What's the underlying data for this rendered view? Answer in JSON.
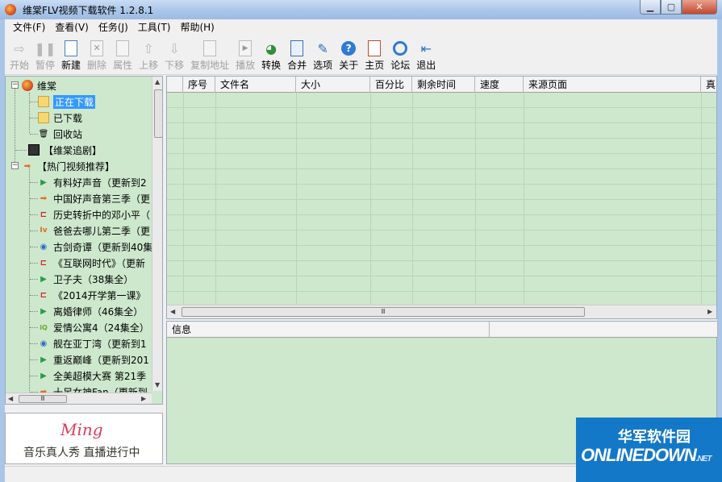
{
  "window": {
    "title": "维棠FLV视频下载软件 1.2.8.1",
    "minimize_icon": "minimize-icon",
    "maximize_icon": "maximize-icon",
    "close_icon": "close-icon"
  },
  "menu": [
    "文件(F)",
    "查看(V)",
    "任务(J)",
    "工具(T)",
    "帮助(H)"
  ],
  "toolbar": [
    {
      "label": "开始",
      "icon": "play-arrow-icon",
      "enabled": false
    },
    {
      "label": "暂停",
      "icon": "pause-icon",
      "enabled": false
    },
    {
      "label": "新建",
      "icon": "new-page-icon",
      "enabled": true
    },
    {
      "label": "删除",
      "icon": "delete-icon",
      "enabled": false
    },
    {
      "label": "属性",
      "icon": "properties-icon",
      "enabled": false
    },
    {
      "label": "上移",
      "icon": "move-up-icon",
      "enabled": false
    },
    {
      "label": "下移",
      "icon": "move-down-icon",
      "enabled": false
    },
    {
      "label": "复制地址",
      "icon": "copy-icon",
      "enabled": false
    },
    {
      "label": "播放",
      "icon": "play-file-icon",
      "enabled": false
    },
    {
      "label": "转换",
      "icon": "convert-icon",
      "enabled": true
    },
    {
      "label": "合并",
      "icon": "merge-icon",
      "enabled": true
    },
    {
      "label": "选项",
      "icon": "options-icon",
      "enabled": true
    },
    {
      "label": "关于",
      "icon": "help-icon",
      "enabled": true
    },
    {
      "label": "主页",
      "icon": "home-icon",
      "enabled": true
    },
    {
      "label": "论坛",
      "icon": "forum-icon",
      "enabled": true
    },
    {
      "label": "退出",
      "icon": "exit-icon",
      "enabled": true
    }
  ],
  "tree": {
    "root": "维棠",
    "children": [
      "正在下载",
      "已下载",
      "回收站"
    ],
    "drama": "【维棠追剧】",
    "hot": "【热门视频推荐】",
    "hot_items": [
      "有料好声音（更新到2",
      "中国好声音第三季（更",
      "历史转折中的邓小平（",
      "爸爸去哪儿第二季（更",
      "古剑奇谭（更新到40集",
      "《互联网时代》（更新",
      "卫子夫（38集全）",
      "《2014开学第一课》",
      "离婚律师（46集全）",
      "爱情公寓4（24集全）",
      "舰在亚丁湾（更新到1",
      "重返巅峰（更新到201",
      "全美超模大赛 第21季",
      "十足女神Fan（更新到"
    ]
  },
  "ad": {
    "logo": "Ming",
    "text": "音乐真人秀 直播进行中"
  },
  "grid": {
    "columns": [
      "",
      "序号",
      "文件名",
      "大小",
      "百分比",
      "剩余时间",
      "速度",
      "来源页面",
      "真实"
    ]
  },
  "info": {
    "columns": [
      "信息",
      ""
    ]
  },
  "scroll": {
    "grip": "Ⅲ"
  },
  "watermark": {
    "cn": "华军软件园",
    "en": "ONLINEDOWN",
    "suffix": ".NET"
  }
}
